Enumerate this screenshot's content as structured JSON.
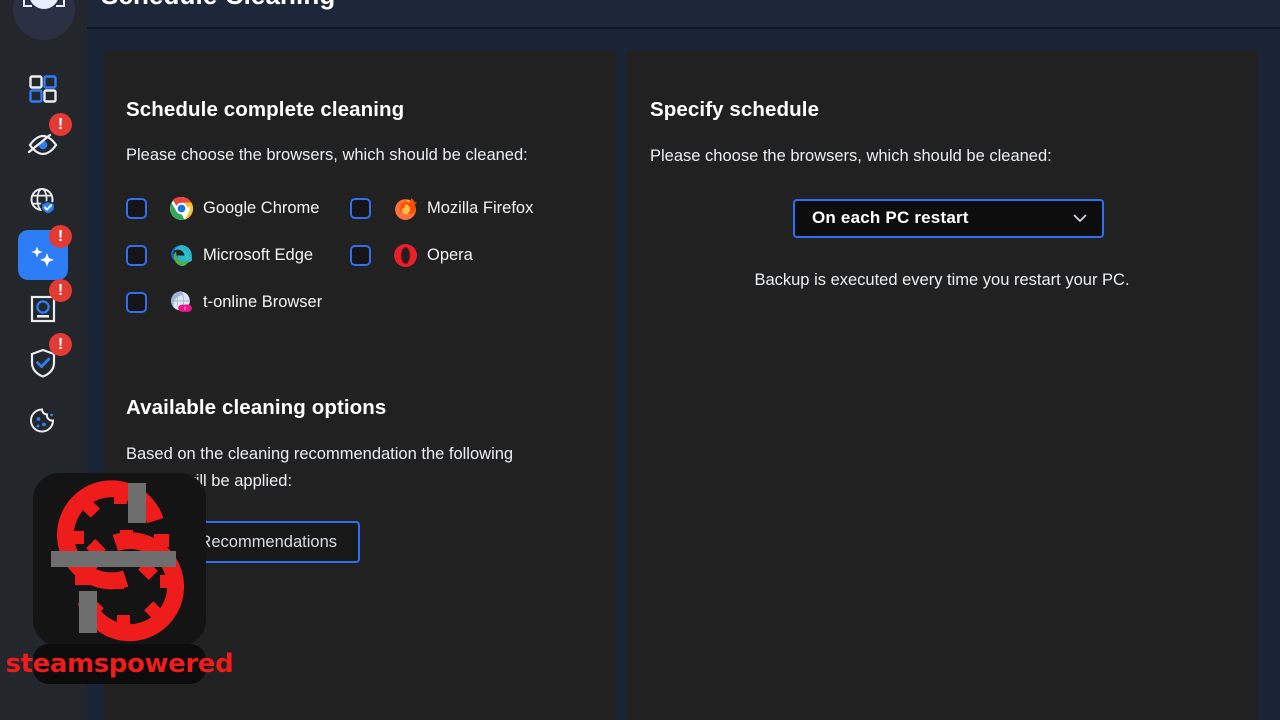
{
  "app": {
    "header_title": "Schedule Cleaning",
    "brand_icon": "scan-eye-logo"
  },
  "colors": {
    "accent_blue": "#2d7df6",
    "checkbox_border": "#2f6ff0",
    "alert_badge_red": "#e23b33",
    "panel_bg": "#212121",
    "page_bg": "#1b2436",
    "sidebar_bg": "#23262a",
    "header_bg": "#1e2739",
    "text_primary": "#ffffff",
    "text_body": "#eceff3",
    "watermark_red": "#f01b1b"
  },
  "sidebar": {
    "items": [
      {
        "name": "dashboard",
        "icon": "grid-squares-icon",
        "active": false,
        "badge": ""
      },
      {
        "name": "privacy",
        "icon": "eye-slash-icon",
        "active": false,
        "badge": "!"
      },
      {
        "name": "web-protection",
        "icon": "globe-shield-icon",
        "active": false,
        "badge": ""
      },
      {
        "name": "cleaning",
        "icon": "sparkles-icon",
        "active": true,
        "badge": "!"
      },
      {
        "name": "identity",
        "icon": "id-card-scan-icon",
        "active": false,
        "badge": "!"
      },
      {
        "name": "security",
        "icon": "shield-check-icon",
        "active": false,
        "badge": "!"
      },
      {
        "name": "cookies",
        "icon": "cookie-icon",
        "active": false,
        "badge": ""
      }
    ]
  },
  "left_top_panel": {
    "title": "Schedule complete cleaning",
    "description": "Please choose the browsers, which should be cleaned:",
    "browsers": [
      {
        "label": "Google Chrome",
        "icon": "chrome-icon",
        "checked": false
      },
      {
        "label": "Mozilla Firefox",
        "icon": "firefox-icon",
        "checked": false
      },
      {
        "label": "Microsoft Edge",
        "icon": "edge-icon",
        "checked": false
      },
      {
        "label": "Opera",
        "icon": "opera-icon",
        "checked": false
      },
      {
        "label": "t-online Browser",
        "icon": "tonline-icon",
        "checked": false
      }
    ]
  },
  "left_bottom_panel": {
    "title": "Available cleaning options",
    "description": "Based on the cleaning recommendation the following options will be applied:",
    "button_label": "Adjust Recommendations"
  },
  "right_panel": {
    "title": "Specify schedule",
    "description": "Please choose the browsers, which should be cleaned:",
    "schedule_select": {
      "selected": "On each PC restart",
      "chevron_icon": "chevron-down-icon"
    },
    "hint": "Backup is executed every time you restart your PC."
  },
  "watermark": {
    "label": "steamspowered",
    "icon": "gears-logo"
  }
}
